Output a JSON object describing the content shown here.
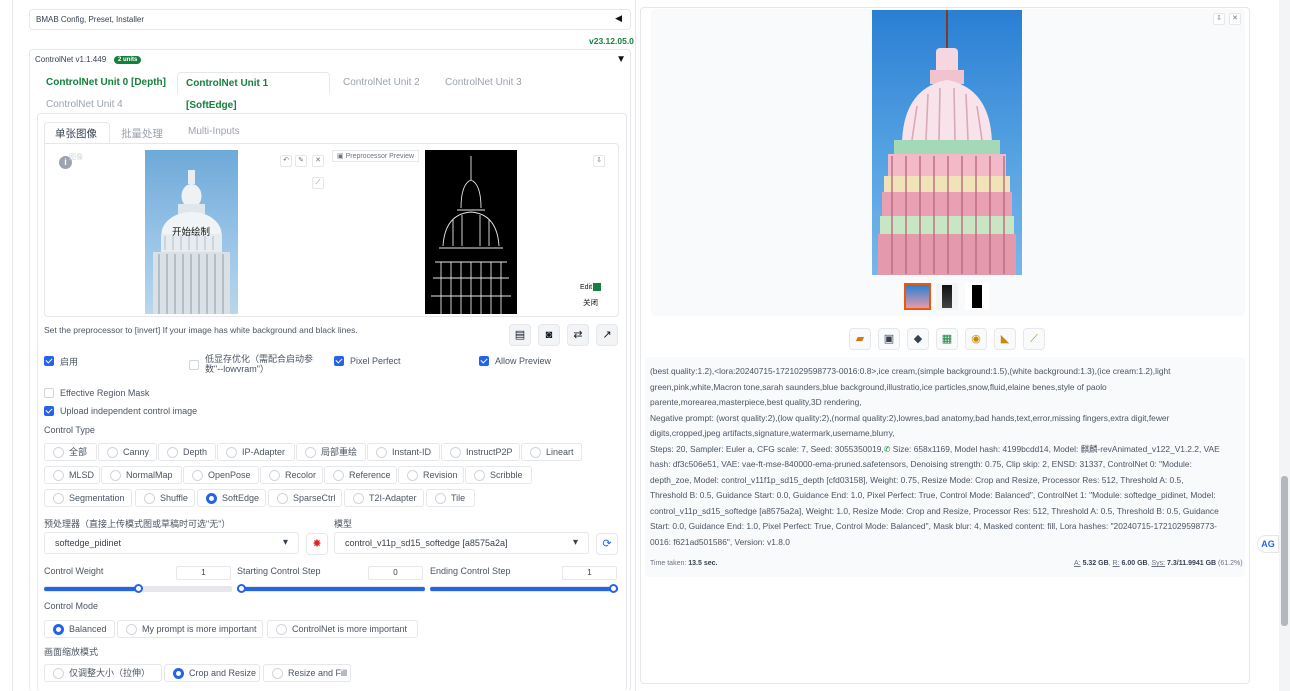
{
  "bmab": {
    "title": "BMAB Config, Preset, Installer",
    "collapse_icon": "◀"
  },
  "version": "v23.12.05.0",
  "controlnet": {
    "title": "ControlNet v1.1.449",
    "badge": "2 units",
    "collapse_icon": "▼",
    "units": [
      "ControlNet Unit 0 [Depth]",
      "ControlNet Unit 1 [SoftEdge]",
      "ControlNet Unit 2",
      "ControlNet Unit 3",
      "ControlNet Unit 4"
    ],
    "subtabs": [
      "单张图像",
      "批量处理",
      "Multi-Inputs"
    ],
    "image_label": "图像",
    "start_draw": "开始绘制",
    "preprocessor_preview": "Preprocessor Preview",
    "edit": "Edit",
    "close": "关闭",
    "hint": "Set the preprocessor to [invert] If your image has white background and black lines.",
    "enable": "启用",
    "lowvram": "低显存优化（需配合启动参数\"--lowvram\"）",
    "pixel_perfect": "Pixel Perfect",
    "allow_preview": "Allow Preview",
    "effective_region_mask": "Effective Region Mask",
    "upload_independent": "Upload independent control image",
    "control_type_label": "Control Type",
    "control_types": [
      "全部",
      "Canny",
      "Depth",
      "IP-Adapter",
      "局部重绘",
      "Instant-ID",
      "InstructP2P",
      "Lineart",
      "MLSD",
      "NormalMap",
      "OpenPose",
      "Recolor",
      "Reference",
      "Revision",
      "Scribble",
      "Segmentation",
      "Shuffle",
      "SoftEdge",
      "SparseCtrl",
      "T2I-Adapter",
      "Tile"
    ],
    "selected_control_type": "SoftEdge",
    "preprocessor_label": "预处理器（直接上传模式图或草稿时可选\"无\"）",
    "preprocessor_value": "softedge_pidinet",
    "model_label": "模型",
    "model_value": "control_v11p_sd15_softedge [a8575a2a]",
    "control_weight_label": "Control Weight",
    "control_weight": "1",
    "control_weight_frac": 1.0,
    "start_step_label": "Starting Control Step",
    "start_step": "0",
    "start_step_frac": 0.0,
    "end_step_label": "Ending Control Step",
    "end_step": "1",
    "end_step_frac": 1.0,
    "control_mode_label": "Control Mode",
    "control_modes": [
      "Balanced",
      "My prompt is more important",
      "ControlNet is more important"
    ],
    "resize_mode_label": "画面缩放模式",
    "resize_modes": [
      "仅调整大小（拉伸）",
      "Crop and Resize",
      "Resize and Fill"
    ]
  },
  "output": {
    "prompt": "(best quality:1.2),<lora:20240715-1721029598773-0016:0.8>,ice cream,(simple background:1.5),(white background:1.3),(ice cream:1.2),light green,pink,white,Macron tone,sarah saunders,blue background,illustratio,ice particles,snow,fluid,elaine benes,style of paolo parente,morearea,masterpiece,best quality,3D rendering,",
    "negative": "Negative prompt: (worst quality:2),(low quality:2),(normal quality:2),lowres,bad anatomy,bad hands,text,error,missing fingers,extra digit,fewer digits,cropped,jpeg artifacts,signature,watermark,username,blurry,",
    "params_a": "Steps: 20, Sampler: Euler a, CFG scale: 7, Seed: 3055350019,",
    "params_b": " Size: 658x1169, Model hash: 4199bcdd14, Model: 麒麟-revAnimated_v122_V1.2.2, VAE hash: df3c506e51, VAE: vae-ft-mse-840000-ema-pruned.safetensors, Denoising strength: 0.75, Clip skip: 2, ENSD: 31337, ControlNet 0: \"Module: depth_zoe, Model: control_v11f1p_sd15_depth [cfd03158], Weight: 0.75, Resize Mode: Crop and Resize, Processor Res: 512, Threshold A: 0.5, Threshold B: 0.5, Guidance Start: 0.0, Guidance End: 1.0, Pixel Perfect: True, Control Mode: Balanced\", ControlNet 1: \"Module: softedge_pidinet, Model: control_v11p_sd15_softedge [a8575a2a], Weight: 1.0, Resize Mode: Crop and Resize, Processor Res: 512, Threshold A: 0.5, Threshold B: 0.5, Guidance Start: 0.0, Guidance End: 1.0, Pixel Perfect: True, Control Mode: Balanced\", Mask blur: 4, Masked content: fill, Lora hashes: \"20240715-1721029598773-0016: f621ad501586\", Version: v1.8.0",
    "time_label": "Time taken:",
    "time_value": "13.5 sec.",
    "mem_a_label": "A:",
    "mem_a": "5.32 GB",
    "mem_r_label": "R:",
    "mem_r": "6.00 GB",
    "mem_sys_label": "Sys:",
    "mem_sys": "7.3/11.9941 GB",
    "mem_pct": "(61.2%)"
  },
  "colors": {
    "accent": "#2563eb",
    "green": "#15803d",
    "sky": "#6ea9d8"
  }
}
